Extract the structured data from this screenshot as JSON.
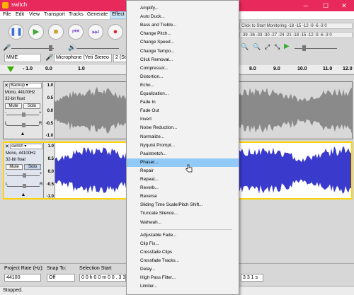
{
  "window": {
    "title": "switch",
    "minimize": "─",
    "maximize": "☐",
    "close": "✕"
  },
  "menubar": [
    "File",
    "Edit",
    "View",
    "Transport",
    "Tracks",
    "Generate",
    "Effect"
  ],
  "meter": {
    "record_hint": "Click to Start Monitoring",
    "scale_top": "-18 -15 -12 -9 -6 -3 0",
    "scale_bottom": "-39 -36 -33 -30 -27 -24 -21 -18 -15 -12 -9 -6 -3 0"
  },
  "devices": {
    "host": "MME",
    "mic": "Microphone (Yeti Stereo",
    "channels": "2 (Ste"
  },
  "ruler": {
    "left_ticks": [
      "- 1.0",
      "0.0",
      "1.0"
    ],
    "right_ticks": [
      "8.0",
      "9.0",
      "10.0",
      "11.0",
      "12.0"
    ]
  },
  "tracks": [
    {
      "name": "Backup",
      "format": "Mono, 44100Hz",
      "bits": "32-bit float",
      "mute": "Mute",
      "solo": "Solo",
      "scale": [
        "1.0",
        "0.5",
        "0.0",
        "-0.5",
        "-1.0"
      ],
      "selected": false,
      "color": "#7a7a7a"
    },
    {
      "name": "switch",
      "format": "Mono, 44100Hz",
      "bits": "32-bit float",
      "mute": "Mute",
      "solo": "Solo",
      "scale": [
        "1.0",
        "0.5",
        "0.0",
        "-0.5",
        "-1.0"
      ],
      "selected": true,
      "color": "#3a3acc"
    }
  ],
  "bottombar": {
    "project_rate_label": "Project Rate (Hz):",
    "project_rate": "44100",
    "snap_label": "Snap To:",
    "snap": "Off",
    "selection_label": "Selection Start",
    "selection_value": "0 0 h 0 0 m 0 0 . 3 3",
    "end_value": "3 3 1 s"
  },
  "status": "Stopped.",
  "effect_menu": {
    "items": [
      "Amplify...",
      "Auto Duck...",
      "Bass and Treble...",
      "Change Pitch...",
      "Change Speed...",
      "Change Tempo...",
      "Click Removal...",
      "Compressor...",
      "Distortion...",
      "Echo...",
      "Equalization...",
      "Fade In",
      "Fade Out",
      "Invert",
      "Noise Reduction...",
      "Normalize...",
      "Nyquist Prompt...",
      "Paulstretch...",
      "Phaser...",
      "Repair",
      "Repeat...",
      "Reverb...",
      "Reverse",
      "Sliding Time Scale/Pitch Shift...",
      "Truncate Silence...",
      "Wahwah..."
    ],
    "highlighted": "Phaser...",
    "items2": [
      "Adjustable Fade...",
      "Clip Fix...",
      "Crossfade Clips",
      "Crossfade Tracks...",
      "Delay...",
      "High Pass Filter...",
      "Limiter..."
    ]
  }
}
